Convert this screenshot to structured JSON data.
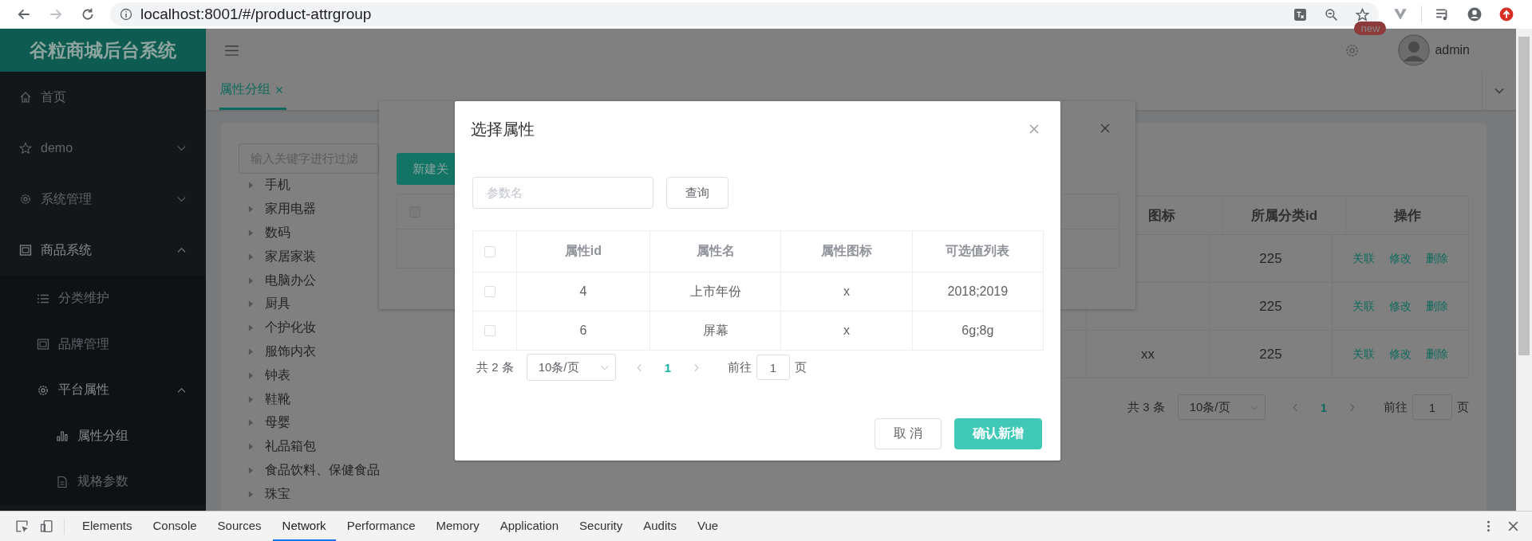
{
  "browser": {
    "url": "localhost:8001/#/product-attrgroup"
  },
  "header": {
    "badge": "new",
    "user": "admin"
  },
  "sidebar": {
    "logo": "谷粒商城后台系统",
    "items": [
      {
        "label": "首页",
        "selected": false
      },
      {
        "label": "demo",
        "expanded": false
      },
      {
        "label": "系统管理",
        "expanded": false
      },
      {
        "label": "商品系统",
        "expanded": true,
        "children": [
          {
            "label": "分类维护",
            "selected": false
          },
          {
            "label": "品牌管理",
            "selected": false
          },
          {
            "label": "平台属性",
            "expanded": true,
            "children": [
              {
                "label": "属性分组",
                "selected": true
              },
              {
                "label": "规格参数",
                "selected": false
              }
            ]
          }
        ]
      }
    ]
  },
  "tabs": [
    {
      "label": "属性分组",
      "selected": true
    }
  ],
  "category_tree": {
    "placeholder": "输入关键字进行过滤",
    "items": [
      {
        "label": "手机",
        "expanded": false
      },
      {
        "label": "家用电器",
        "expanded": false
      },
      {
        "label": "数码",
        "expanded": false
      },
      {
        "label": "家居家装",
        "expanded": false
      },
      {
        "label": "电脑办公",
        "expanded": false
      },
      {
        "label": "厨具",
        "expanded": false
      },
      {
        "label": "个护化妆",
        "expanded": false
      },
      {
        "label": "服饰内衣",
        "expanded": false
      },
      {
        "label": "钟表",
        "expanded": false
      },
      {
        "label": "鞋靴",
        "expanded": false
      },
      {
        "label": "母婴",
        "expanded": false
      },
      {
        "label": "礼品箱包",
        "expanded": false
      },
      {
        "label": "食品饮料、保健食品",
        "expanded": false
      },
      {
        "label": "珠宝",
        "expanded": false
      }
    ]
  },
  "attr_group_table": {
    "columns": [
      "图标",
      "所属分类id",
      "操作"
    ],
    "rows": [
      {
        "category_id": "225",
        "actions": [
          "关联",
          "修改",
          "删除"
        ]
      },
      {
        "category_id": "225",
        "actions": [
          "关联",
          "修改",
          "删除"
        ]
      },
      {
        "icon": "xx",
        "category_id": "225",
        "actions": [
          "关联",
          "修改",
          "删除"
        ]
      }
    ],
    "pagination": {
      "total": "共 3 条",
      "page_size": "10条/页",
      "pages": [
        {
          "label": "1",
          "selected": true
        }
      ],
      "goto_label": "前往",
      "goto_value": "1",
      "page_unit": "页"
    }
  },
  "relation_dialog": {
    "new_button": "新建关",
    "header_checked": false
  },
  "attr_dialog": {
    "title": "选择属性",
    "search_placeholder": "参数名",
    "search_button": "查询",
    "header_checked": false,
    "columns": [
      "属性id",
      "属性名",
      "属性图标",
      "可选值列表"
    ],
    "rows": [
      {
        "checked": false,
        "cells": [
          "4",
          "上市年份",
          "x",
          "2018;2019"
        ]
      },
      {
        "checked": false,
        "cells": [
          "6",
          "屏幕",
          "x",
          "6g;8g"
        ]
      }
    ],
    "pagination": {
      "total": "共 2 条",
      "page_size": "10条/页",
      "pages": [
        {
          "label": "1",
          "selected": true
        }
      ],
      "goto_label": "前往",
      "goto_value": "1",
      "page_unit": "页"
    },
    "buttons": [
      {
        "label": "取 消",
        "kind": "default"
      },
      {
        "label": "确认新增",
        "kind": "primary"
      }
    ]
  },
  "devtools": {
    "tabs": [
      {
        "label": "Elements",
        "selected": false
      },
      {
        "label": "Console",
        "selected": false
      },
      {
        "label": "Sources",
        "selected": false
      },
      {
        "label": "Network",
        "selected": true
      },
      {
        "label": "Performance",
        "selected": false
      },
      {
        "label": "Memory",
        "selected": false
      },
      {
        "label": "Application",
        "selected": false
      },
      {
        "label": "Security",
        "selected": false
      },
      {
        "label": "Audits",
        "selected": false
      },
      {
        "label": "Vue",
        "selected": false
      }
    ]
  }
}
